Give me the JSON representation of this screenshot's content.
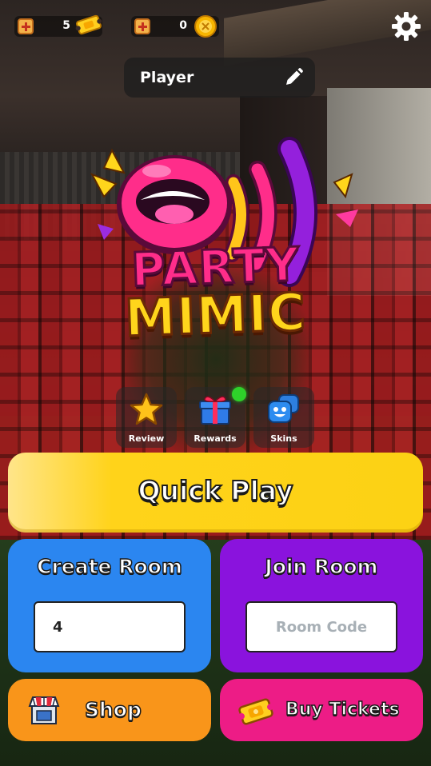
{
  "currencies": {
    "tickets": {
      "value": "5",
      "icon": "ticket-icon"
    },
    "coins": {
      "value": "0",
      "icon": "coin-icon"
    }
  },
  "header": {
    "settings_icon": "gear-icon",
    "player_name": "Player",
    "edit_icon": "pencil-icon"
  },
  "logo": {
    "line1": "PARTY",
    "line2": "MIMIC"
  },
  "features": [
    {
      "label": "Review",
      "icon": "star-icon"
    },
    {
      "label": "Rewards",
      "icon": "gift-icon"
    },
    {
      "label": "Skins",
      "icon": "skins-face-icon",
      "has_notification": true
    }
  ],
  "actions": {
    "quick_play": "Quick Play",
    "create_room": {
      "title": "Create Room",
      "input_value": "4"
    },
    "join_room": {
      "title": "Join Room",
      "placeholder": "Room Code"
    },
    "shop": {
      "label": "Shop",
      "icon": "shop-icon"
    },
    "buy_tickets": {
      "label": "Buy Tickets",
      "icon": "ticket-icon"
    }
  },
  "colors": {
    "quick_play": "#fcd214",
    "create_room": "#2b86f0",
    "join_room": "#8a13dd",
    "shop": "#f9951a",
    "buy_tickets": "#ed1c86",
    "notification": "#2ed12a"
  }
}
